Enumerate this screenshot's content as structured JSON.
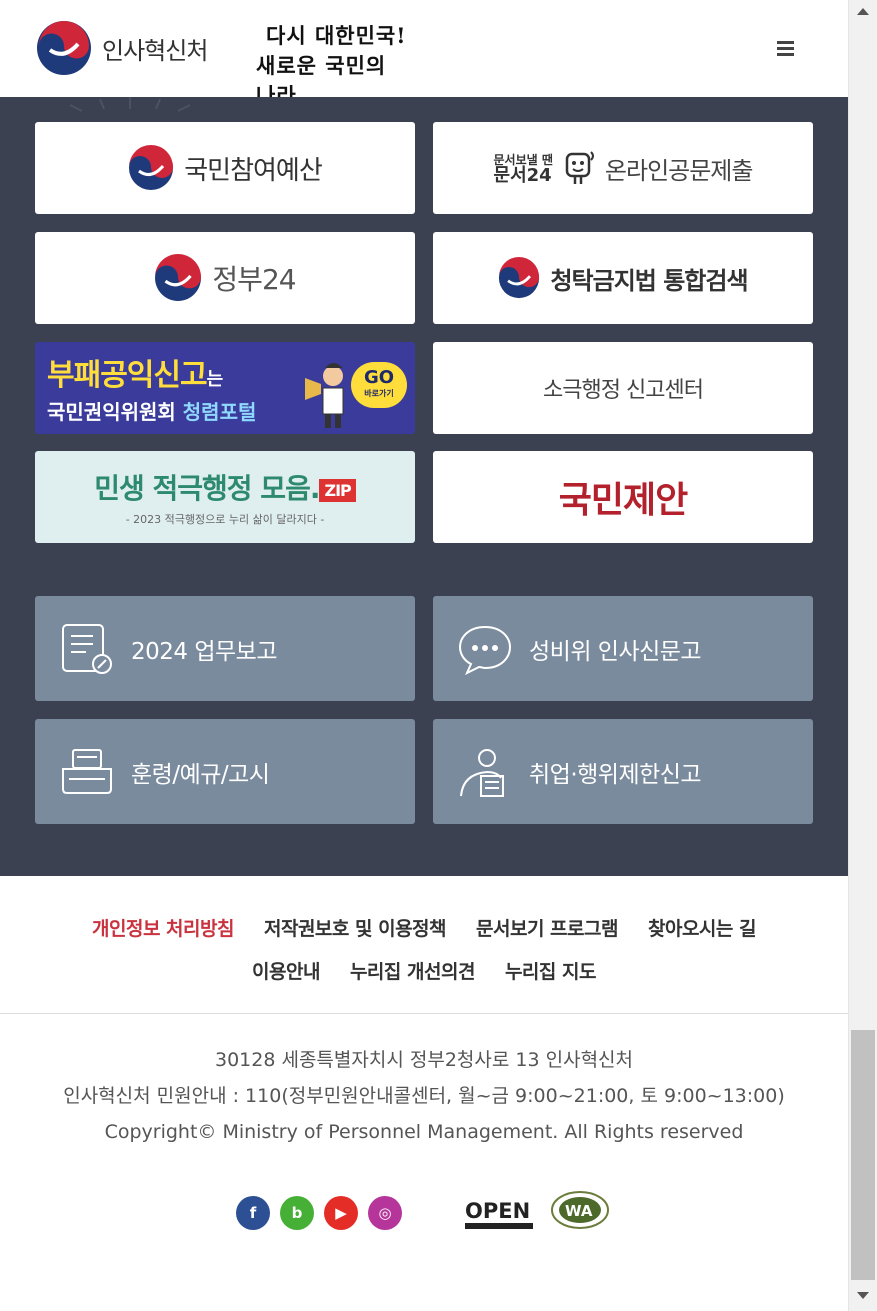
{
  "header": {
    "logo_text": "인사혁신처",
    "slogan_line1": "다시 대한민국!",
    "slogan_line2": "새로운 국민의 나라",
    "menu_icon": "hamburger-icon"
  },
  "banners": {
    "b1": "국민참여예산",
    "b2_mini1": "문서보낼 땐",
    "b2_mini2": "문서24",
    "b2": "온라인공문제출",
    "b3": "정부24",
    "b4": "청탁금지법 통합검색",
    "b5_title": "부패공익신고",
    "b5_title_suffix": "는",
    "b5_sub1": "국민권익위원회",
    "b5_sub2": "청렴포털",
    "b5_go": "GO",
    "b5_go_sub": "바로가기",
    "b6": "소극행정 신고센터",
    "b7_title": "민생 적극행정 모음.",
    "b7_zip": "ZIP",
    "b7_sub": "- 2023 적극행정으로 누리 삶이 달라지다 -",
    "b8": "국민제안"
  },
  "tiles": [
    {
      "label": "2024 업무보고",
      "icon": "report-document-icon"
    },
    {
      "label": "성비위 인사신문고",
      "icon": "chat-bubble-icon"
    },
    {
      "label": "훈령/예규/고시",
      "icon": "printer-icon"
    },
    {
      "label": "취업·행위제한신고",
      "icon": "person-report-icon"
    }
  ],
  "footer": {
    "links_row1": [
      "개인정보 처리방침",
      "저작권보호 및 이용정책",
      "문서보기 프로그램",
      "찾아오시는 길"
    ],
    "links_row2": [
      "이용안내",
      "누리집 개선의견",
      "누리집 지도"
    ],
    "address": "30128 세종특별자치시 정부2청사로 13 인사혁신처",
    "contact": "인사혁신처 민원안내 : 110(정부민원안내콜센터, 월~금 9:00~21:00, 토 9:00~13:00)",
    "copyright": "Copyright© Ministry of Personnel Management. All Rights reserved",
    "social": [
      "f",
      "b",
      "▶",
      "◎"
    ],
    "open_label": "OPEN",
    "wa_label": "WA"
  },
  "colors": {
    "dark_bg": "#3b4150",
    "tile_bg": "#7b8b9e",
    "accent_red": "#c9333f"
  }
}
